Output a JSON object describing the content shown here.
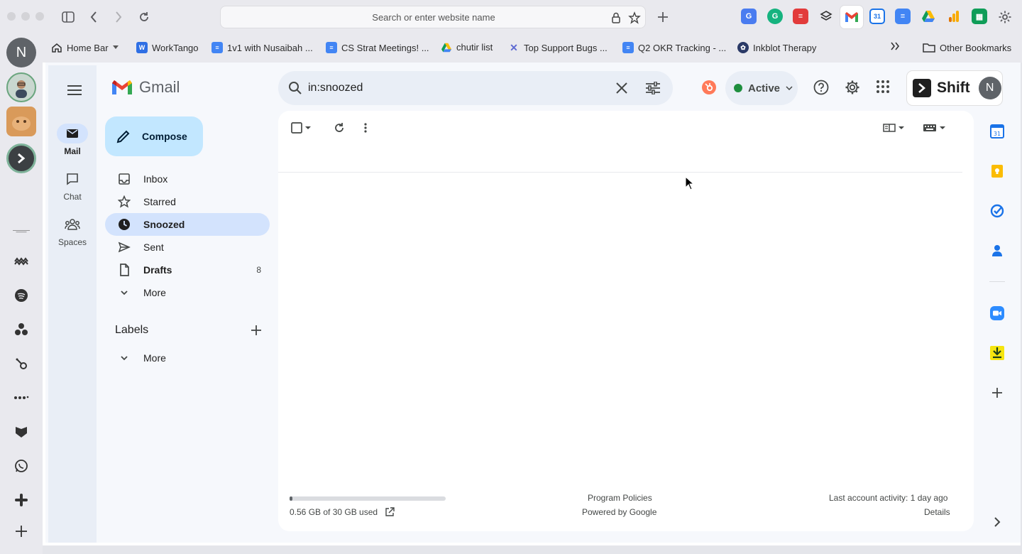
{
  "browser": {
    "url_placeholder": "Search or enter website name",
    "bookmarks": [
      {
        "label": "Home Bar",
        "icon": "home-icon"
      },
      {
        "label": "WorkTango",
        "icon": "worktango-icon"
      },
      {
        "label": "1v1 with Nusaibah ...",
        "icon": "docs-icon"
      },
      {
        "label": "CS Strat Meetings! ...",
        "icon": "docs-icon"
      },
      {
        "label": "chutir list",
        "icon": "drive-icon"
      },
      {
        "label": "Top Support Bugs ...",
        "icon": "linear-icon"
      },
      {
        "label": "Q2 OKR Tracking - ...",
        "icon": "docs-icon"
      },
      {
        "label": "Inkblot Therapy",
        "icon": "inkblot-icon"
      }
    ],
    "other_bookmarks": "Other Bookmarks"
  },
  "dock": {
    "avatar_initial": "N"
  },
  "gmail": {
    "brand": "Gmail",
    "rail": [
      {
        "label": "Mail",
        "icon": "mail-icon",
        "selected": true
      },
      {
        "label": "Chat",
        "icon": "chat-icon",
        "selected": false
      },
      {
        "label": "Spaces",
        "icon": "spaces-icon",
        "selected": false
      }
    ],
    "compose_label": "Compose",
    "nav": [
      {
        "label": "Inbox",
        "icon": "inbox-icon",
        "count": ""
      },
      {
        "label": "Starred",
        "icon": "star-icon",
        "count": ""
      },
      {
        "label": "Snoozed",
        "icon": "clock-icon",
        "count": ""
      },
      {
        "label": "Sent",
        "icon": "send-icon",
        "count": ""
      },
      {
        "label": "Drafts",
        "icon": "draft-icon",
        "count": "8"
      },
      {
        "label": "More",
        "icon": "chevron-down-icon",
        "count": ""
      }
    ],
    "labels_heading": "Labels",
    "labels_more": "More",
    "search_value": "in:snoozed",
    "status_label": "Active",
    "shift_brand": "Shift",
    "account_initial": "N",
    "footer": {
      "storage_used": "0.56 GB of 30 GB used",
      "storage_fraction": 0.019,
      "program_policies": "Program Policies",
      "powered_by": "Powered by Google",
      "last_activity": "Last account activity: 1 day ago",
      "details": "Details"
    }
  },
  "colors": {
    "accent_blue": "#0b57d0",
    "selected_bg": "#d3e3fd",
    "compose_bg": "#c2e7ff",
    "active_green": "#1e8e3e",
    "gmail_red": "#ea4335"
  }
}
